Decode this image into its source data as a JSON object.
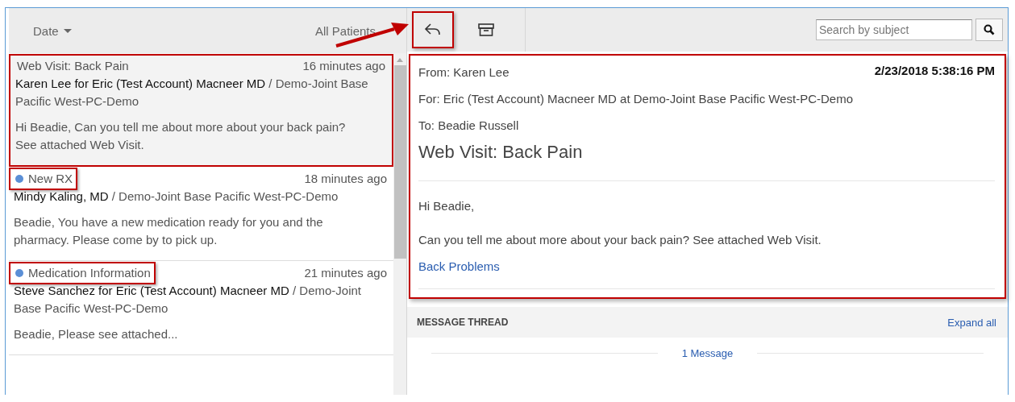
{
  "list_header": {
    "sort": "Date",
    "filter": "All Patients"
  },
  "messages": [
    {
      "subject": "Web Visit: Back Pain",
      "time": "16 minutes ago",
      "sender": "Karen Lee for Eric (Test Account) Macneer MD",
      "location": "/ Demo-Joint Base Pacific West-PC-Demo",
      "preview": "Hi Beadie, Can you tell me about more about your back pain? See attached Web Visit.",
      "selected": true,
      "unread": false,
      "highlighted": true,
      "subject_highlighted": false
    },
    {
      "subject": "New RX",
      "time": "18 minutes ago",
      "sender": "Mindy Kaling, MD",
      "location": "/ Demo-Joint Base Pacific West-PC-Demo",
      "preview": "Beadie, You have a new medication ready for you and the pharmacy. Please come by to pick up.",
      "selected": false,
      "unread": true,
      "highlighted": false,
      "subject_highlighted": true
    },
    {
      "subject": "Medication Information",
      "time": "21 minutes ago",
      "sender": "Steve Sanchez for Eric (Test Account) Macneer MD",
      "location": "/ Demo-Joint Base Pacific West-PC-Demo",
      "preview": "Beadie, Please see attached...",
      "selected": false,
      "unread": true,
      "highlighted": false,
      "subject_highlighted": true
    }
  ],
  "toolbar": {
    "reply_highlighted": true,
    "callout_arrow": true,
    "search": {
      "placeholder": "Search by subject"
    }
  },
  "detail": {
    "highlighted": true,
    "from": "From: Karen Lee",
    "date": "2/23/2018 5:38:16 PM",
    "for": "For: Eric (Test Account) Macneer MD at Demo-Joint Base Pacific West-PC-Demo",
    "to": "To: Beadie Russell",
    "title": "Web Visit: Back Pain",
    "greeting": "Hi Beadie,",
    "body": "Can you tell me about more about your back pain? See attached Web Visit.",
    "attachment": "Back Problems"
  },
  "thread": {
    "title": "MESSAGE THREAD",
    "expand": "Expand all",
    "count": "1 Message"
  }
}
